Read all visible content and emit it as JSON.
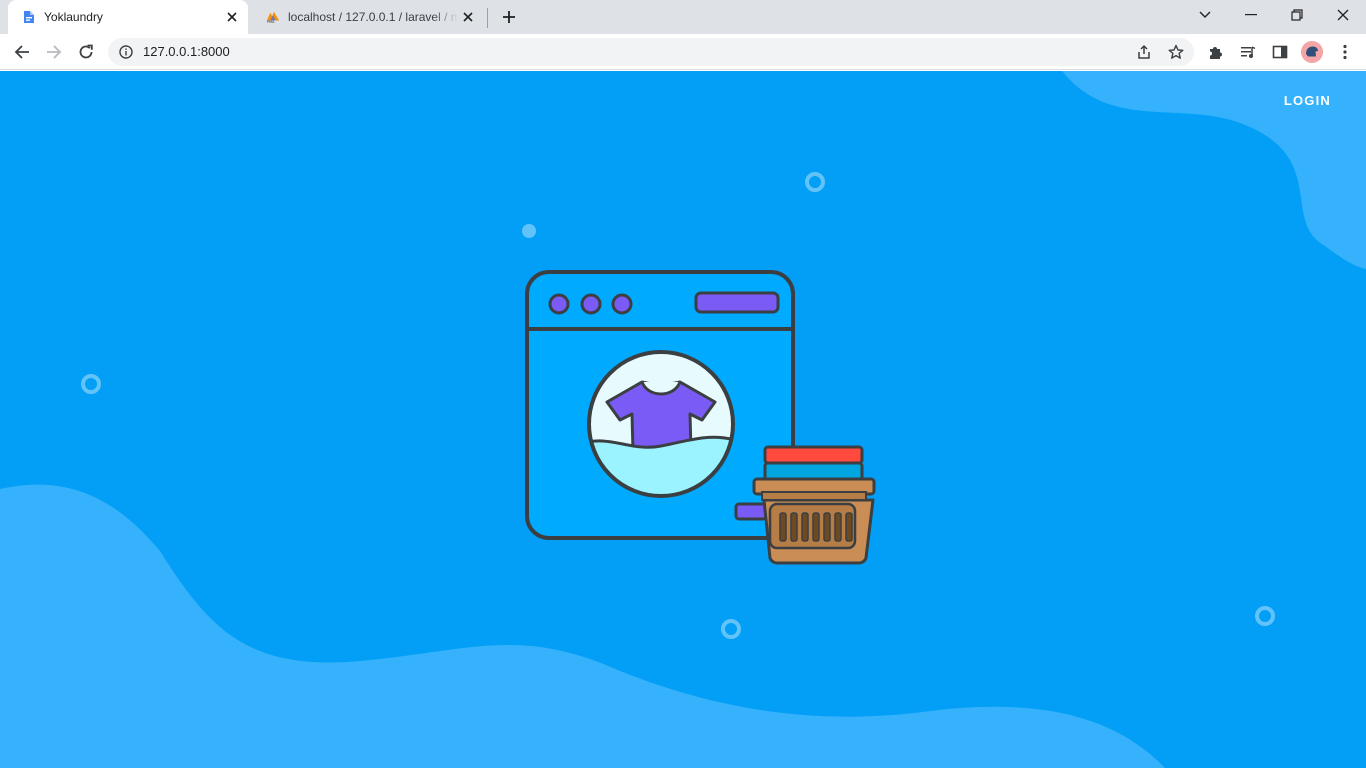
{
  "browser": {
    "tabs": [
      {
        "title": "Yoklaundry",
        "favicon": "page-icon",
        "active": true
      },
      {
        "title": "localhost / 127.0.0.1 / laravel / m",
        "favicon": "phpmyadmin-icon",
        "active": false
      }
    ],
    "url": "127.0.0.1:8000",
    "accent": "#1a73e8"
  },
  "page": {
    "nav": {
      "login_label": "LOGIN"
    },
    "colors": {
      "background": "#039ff6",
      "wave": "#35b2fb",
      "machine_body": "#00aaff",
      "outline": "#3b3f42",
      "knob": "#7b5bf5",
      "shirt": "#7b5bf5",
      "water": "#9af3ff",
      "basket": "#c98d55",
      "cloth_top": "#ff4a3d",
      "cloth_bottom": "#00a6e0"
    },
    "illustration": "washing-machine-with-laundry-basket"
  }
}
